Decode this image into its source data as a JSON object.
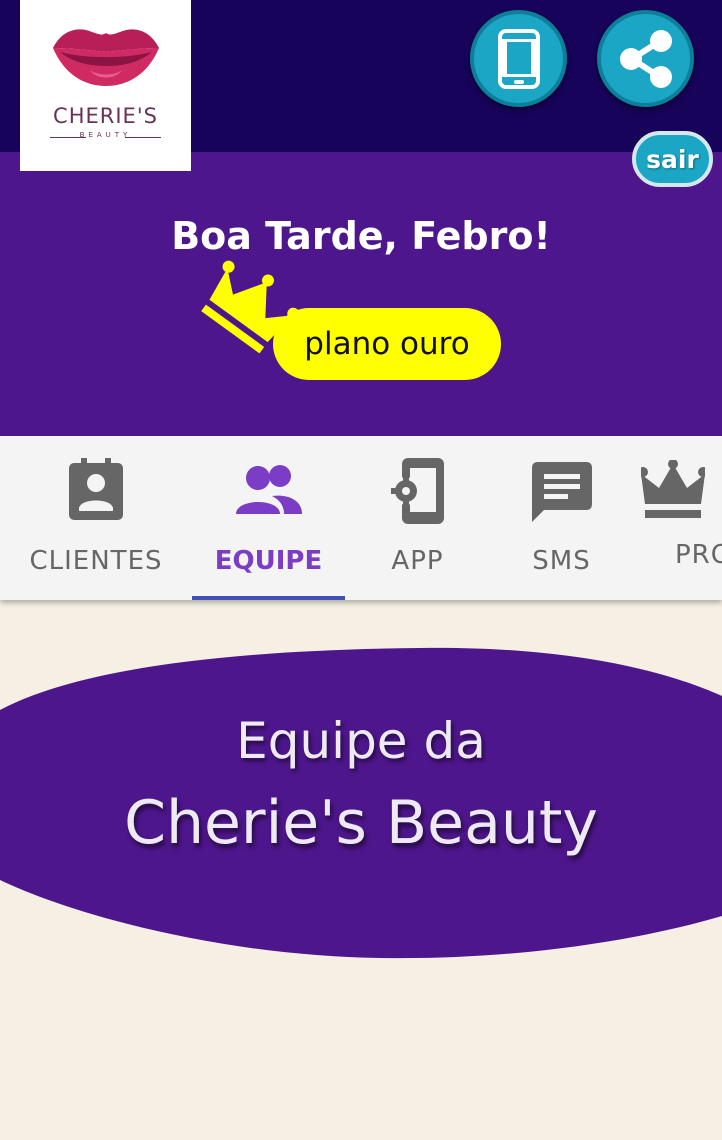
{
  "brand": {
    "name": "CHERIE'S",
    "subtitle": "BEAUTY"
  },
  "header": {
    "phone_icon": "smartphone-icon",
    "share_icon": "share-icon",
    "logout_label": "sair"
  },
  "banner": {
    "greeting": "Boa Tarde, Febro!",
    "plan_label": "plano ouro",
    "plan_icon": "crown-icon"
  },
  "tabs": [
    {
      "label": "CLIENTES",
      "icon": "contact-card-icon",
      "active": false
    },
    {
      "label": "EQUIPE",
      "icon": "people-icon",
      "active": true
    },
    {
      "label": "APP",
      "icon": "phone-settings-icon",
      "active": false
    },
    {
      "label": "SMS",
      "icon": "message-icon",
      "active": false
    },
    {
      "label": "PRO",
      "icon": "crown-icon",
      "active": false
    }
  ],
  "hero": {
    "line1": "Equipe da",
    "line2": "Cherie's Beauty"
  },
  "colors": {
    "top_bar": "#17035a",
    "banner": "#4e168c",
    "accent_cyan": "#1aa6c4",
    "plan_yellow": "#ffff00",
    "active_tab": "#7b3cc6",
    "tab_indicator": "#3f51b5",
    "page_background": "#f6efe4"
  }
}
